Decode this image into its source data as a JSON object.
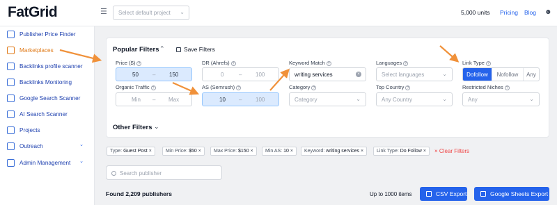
{
  "header": {
    "logo": "FatGrid",
    "project_placeholder": "Select default project",
    "units": "5,000 units",
    "pricing": "Pricing",
    "blog": "Blog"
  },
  "sidebar": {
    "items": [
      {
        "label": "Publisher Price Finder"
      },
      {
        "label": "Marketplaces"
      },
      {
        "label": "Backlinks profile scanner"
      },
      {
        "label": "Backlinks Monitoring"
      },
      {
        "label": "Google Search Scanner"
      },
      {
        "label": "AI Search Scanner"
      },
      {
        "label": "Projects"
      },
      {
        "label": "Outreach"
      },
      {
        "label": "Admin Management"
      }
    ]
  },
  "filters": {
    "title": "Popular Filters",
    "save_label": "Save Filters",
    "price": {
      "label": "Price ($)",
      "min": "50",
      "max": "150"
    },
    "dr": {
      "label": "DR (Ahrefs)",
      "min": "0",
      "max": "100"
    },
    "keyword": {
      "label": "Keyword Match",
      "value": "writing services"
    },
    "languages": {
      "label": "Languages",
      "placeholder": "Select languages"
    },
    "link_type": {
      "label": "Link Type",
      "options": [
        "Dofollow",
        "Nofollow",
        "Any"
      ]
    },
    "organic": {
      "label": "Organic Traffic",
      "min": "Min",
      "max": "Max"
    },
    "as": {
      "label": "AS (Semrush)",
      "min": "10",
      "max": "100"
    },
    "category": {
      "label": "Category",
      "placeholder": "Category"
    },
    "top_country": {
      "label": "Top Country",
      "placeholder": "Any Country"
    },
    "niches": {
      "label": "Restricted Niches",
      "placeholder": "Any"
    },
    "other_title": "Other Filters"
  },
  "chips": [
    {
      "label": "Type: ",
      "value": "Guest Post"
    },
    {
      "label": "Min Price: ",
      "value": "$50"
    },
    {
      "label": "Max Price: ",
      "value": "$150"
    },
    {
      "label": "Min AS: ",
      "value": "10"
    },
    {
      "label": "Keyword: ",
      "value": "writing services"
    },
    {
      "label": "Link Type: ",
      "value": "Do Follow"
    }
  ],
  "clear_filters": "Clear Filters",
  "search_placeholder": "Search publisher",
  "results": {
    "found": "Found 2,209 publishers",
    "up_to": "Up to 1000 items",
    "csv": "CSV Export",
    "sheets": "Google Sheets Export"
  },
  "colors": {
    "accent": "#2563eb",
    "active_nav": "#e07b1a",
    "arrow": "#f0913a"
  }
}
